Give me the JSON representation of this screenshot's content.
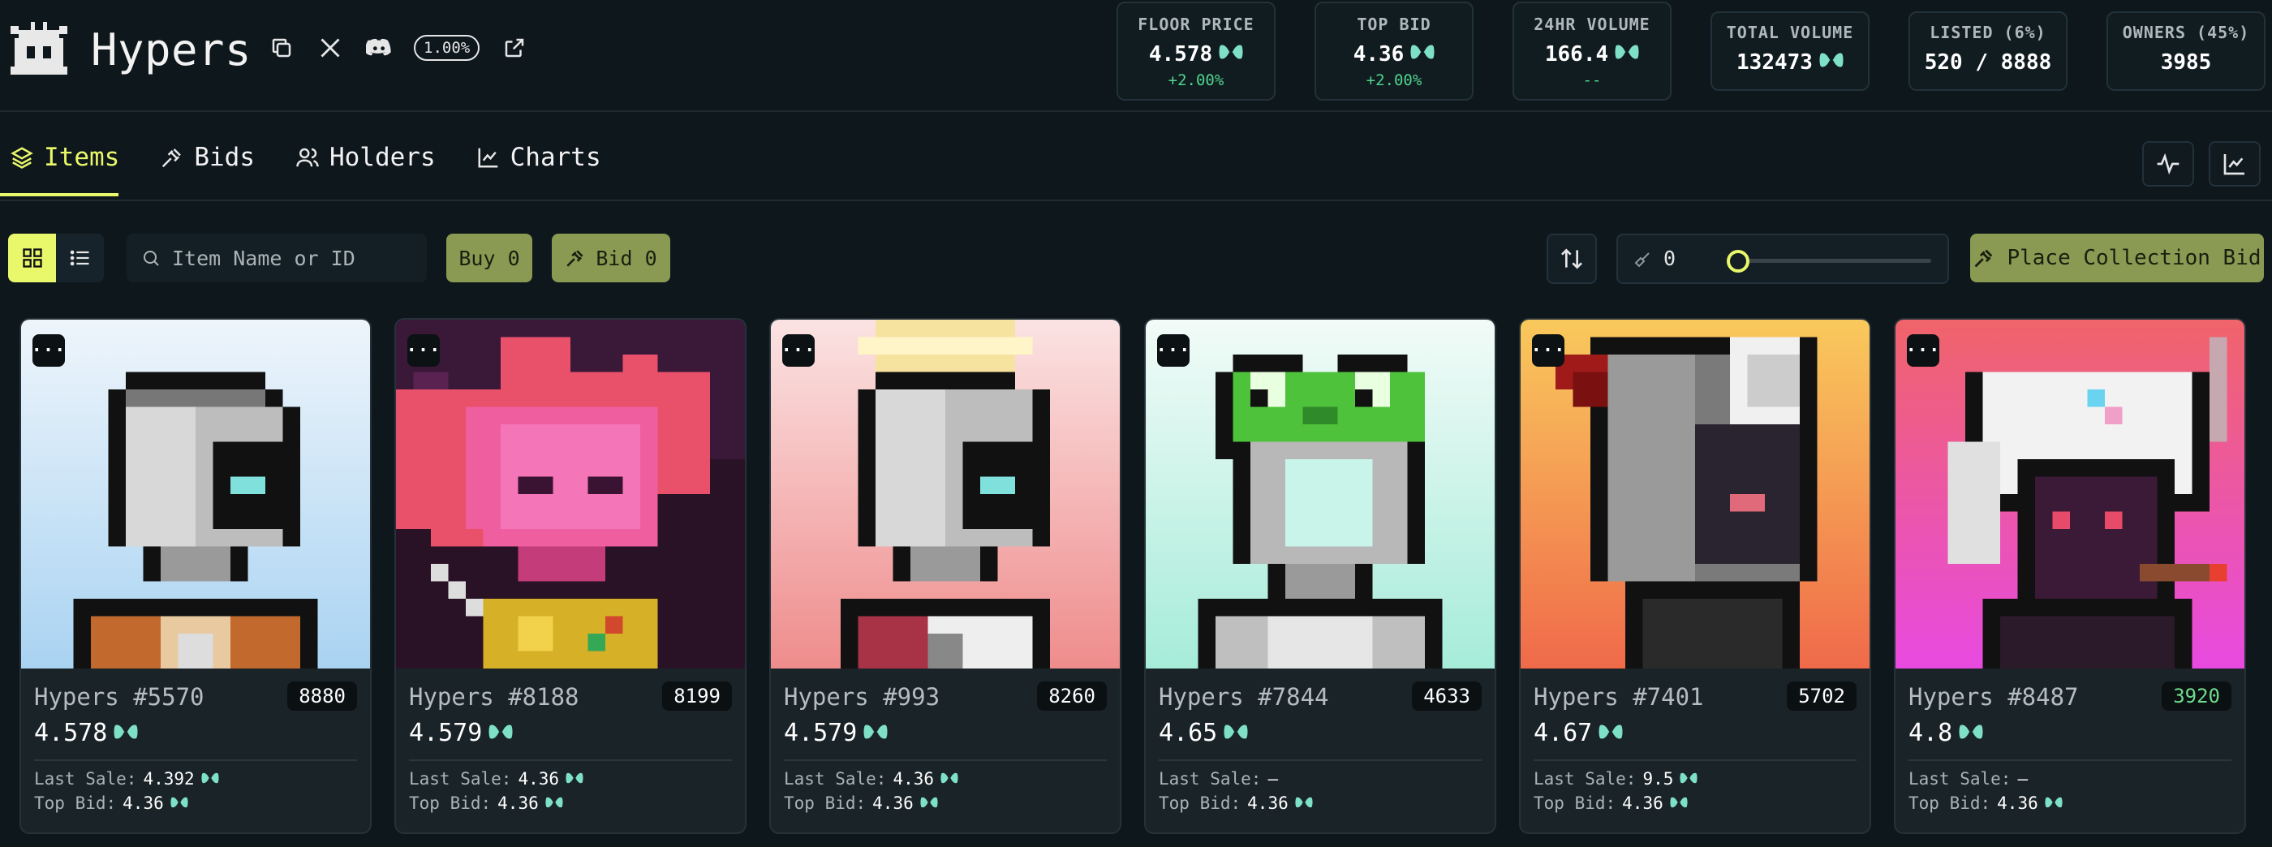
{
  "header": {
    "brand": "Hypers",
    "royalty": "1.00%",
    "stats": [
      {
        "label": "FLOOR PRICE",
        "value": "4.578",
        "change": "+2.00%",
        "currency": true
      },
      {
        "label": "TOP BID",
        "value": "4.36",
        "change": "+2.00%",
        "currency": true
      },
      {
        "label": "24HR VOLUME",
        "value": "166.4",
        "change": "--",
        "currency": true
      },
      {
        "label": "TOTAL VOLUME",
        "value": "132473",
        "change": "",
        "currency": true
      },
      {
        "label": "LISTED (6%)",
        "value": "520 / 8888",
        "change": "",
        "currency": false
      },
      {
        "label": "OWNERS (45%)",
        "value": "3985",
        "change": "",
        "currency": false
      }
    ]
  },
  "tabs": [
    {
      "label": "Items",
      "icon": "layers-icon",
      "active": true
    },
    {
      "label": "Bids",
      "icon": "gavel-icon",
      "active": false
    },
    {
      "label": "Holders",
      "icon": "users-icon",
      "active": false
    },
    {
      "label": "Charts",
      "icon": "line-chart-icon",
      "active": false
    }
  ],
  "toolbar": {
    "search_placeholder": "Item Name or ID",
    "buy_label": "Buy 0",
    "bid_label": "Bid 0",
    "sweep_count": "0",
    "sweep_level": 0,
    "collection_bid_label": "Place Collection Bid"
  },
  "cards": [
    {
      "name": "Hypers #5570",
      "rank": "8880",
      "price": "4.578",
      "last_sale_label": "Last Sale:",
      "last_sale": "4.392",
      "top_bid_label": "Top Bid:",
      "top_bid": "4.36"
    },
    {
      "name": "Hypers #8188",
      "rank": "8199",
      "price": "4.579",
      "last_sale_label": "Last Sale:",
      "last_sale": "4.36",
      "top_bid_label": "Top Bid:",
      "top_bid": "4.36"
    },
    {
      "name": "Hypers #993",
      "rank": "8260",
      "price": "4.579",
      "last_sale_label": "Last Sale:",
      "last_sale": "4.36",
      "top_bid_label": "Top Bid:",
      "top_bid": "4.36"
    },
    {
      "name": "Hypers #7844",
      "rank": "4633",
      "price": "4.65",
      "last_sale_label": "Last Sale:",
      "last_sale": "–",
      "top_bid_label": "Top Bid:",
      "top_bid": "4.36"
    },
    {
      "name": "Hypers #7401",
      "rank": "5702",
      "price": "4.67",
      "last_sale_label": "Last Sale:",
      "last_sale": "9.5",
      "top_bid_label": "Top Bid:",
      "top_bid": "4.36"
    },
    {
      "name": "Hypers #8487",
      "rank": "3920",
      "price": "4.8",
      "last_sale_label": "Last Sale:",
      "last_sale": "–",
      "top_bid_label": "Top Bid:",
      "top_bid": "4.36"
    }
  ],
  "colors": {
    "accent": "#e9f76a",
    "olive": "#8a9a52",
    "positive": "#4fd48c",
    "hype_token": "#7fe0c8"
  }
}
